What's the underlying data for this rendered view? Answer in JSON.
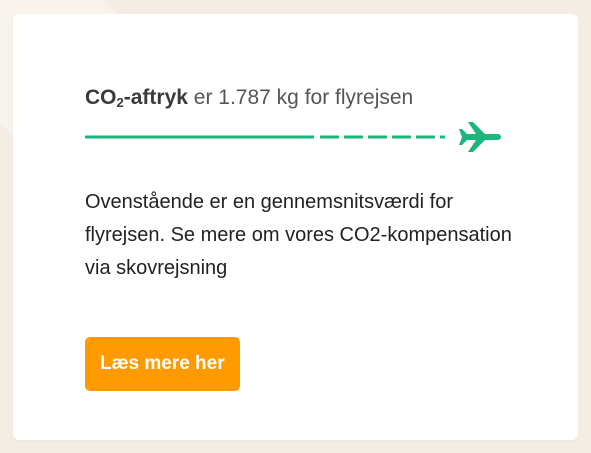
{
  "co2": {
    "label_prefix": "CO",
    "label_subscript": "2",
    "label_suffix": "-aftryk",
    "value_text": "er 1.787 kg for flyrejsen"
  },
  "route": {
    "line_color": "#1bb77a",
    "icon": "airplane-icon"
  },
  "description": "Ovenstående er en gennemsnitsværdi for flyrejsen. Se mere om vores CO2-kompensation via skovrejsning",
  "button": {
    "label": "Læs mere her",
    "color": "#ff9b00"
  }
}
